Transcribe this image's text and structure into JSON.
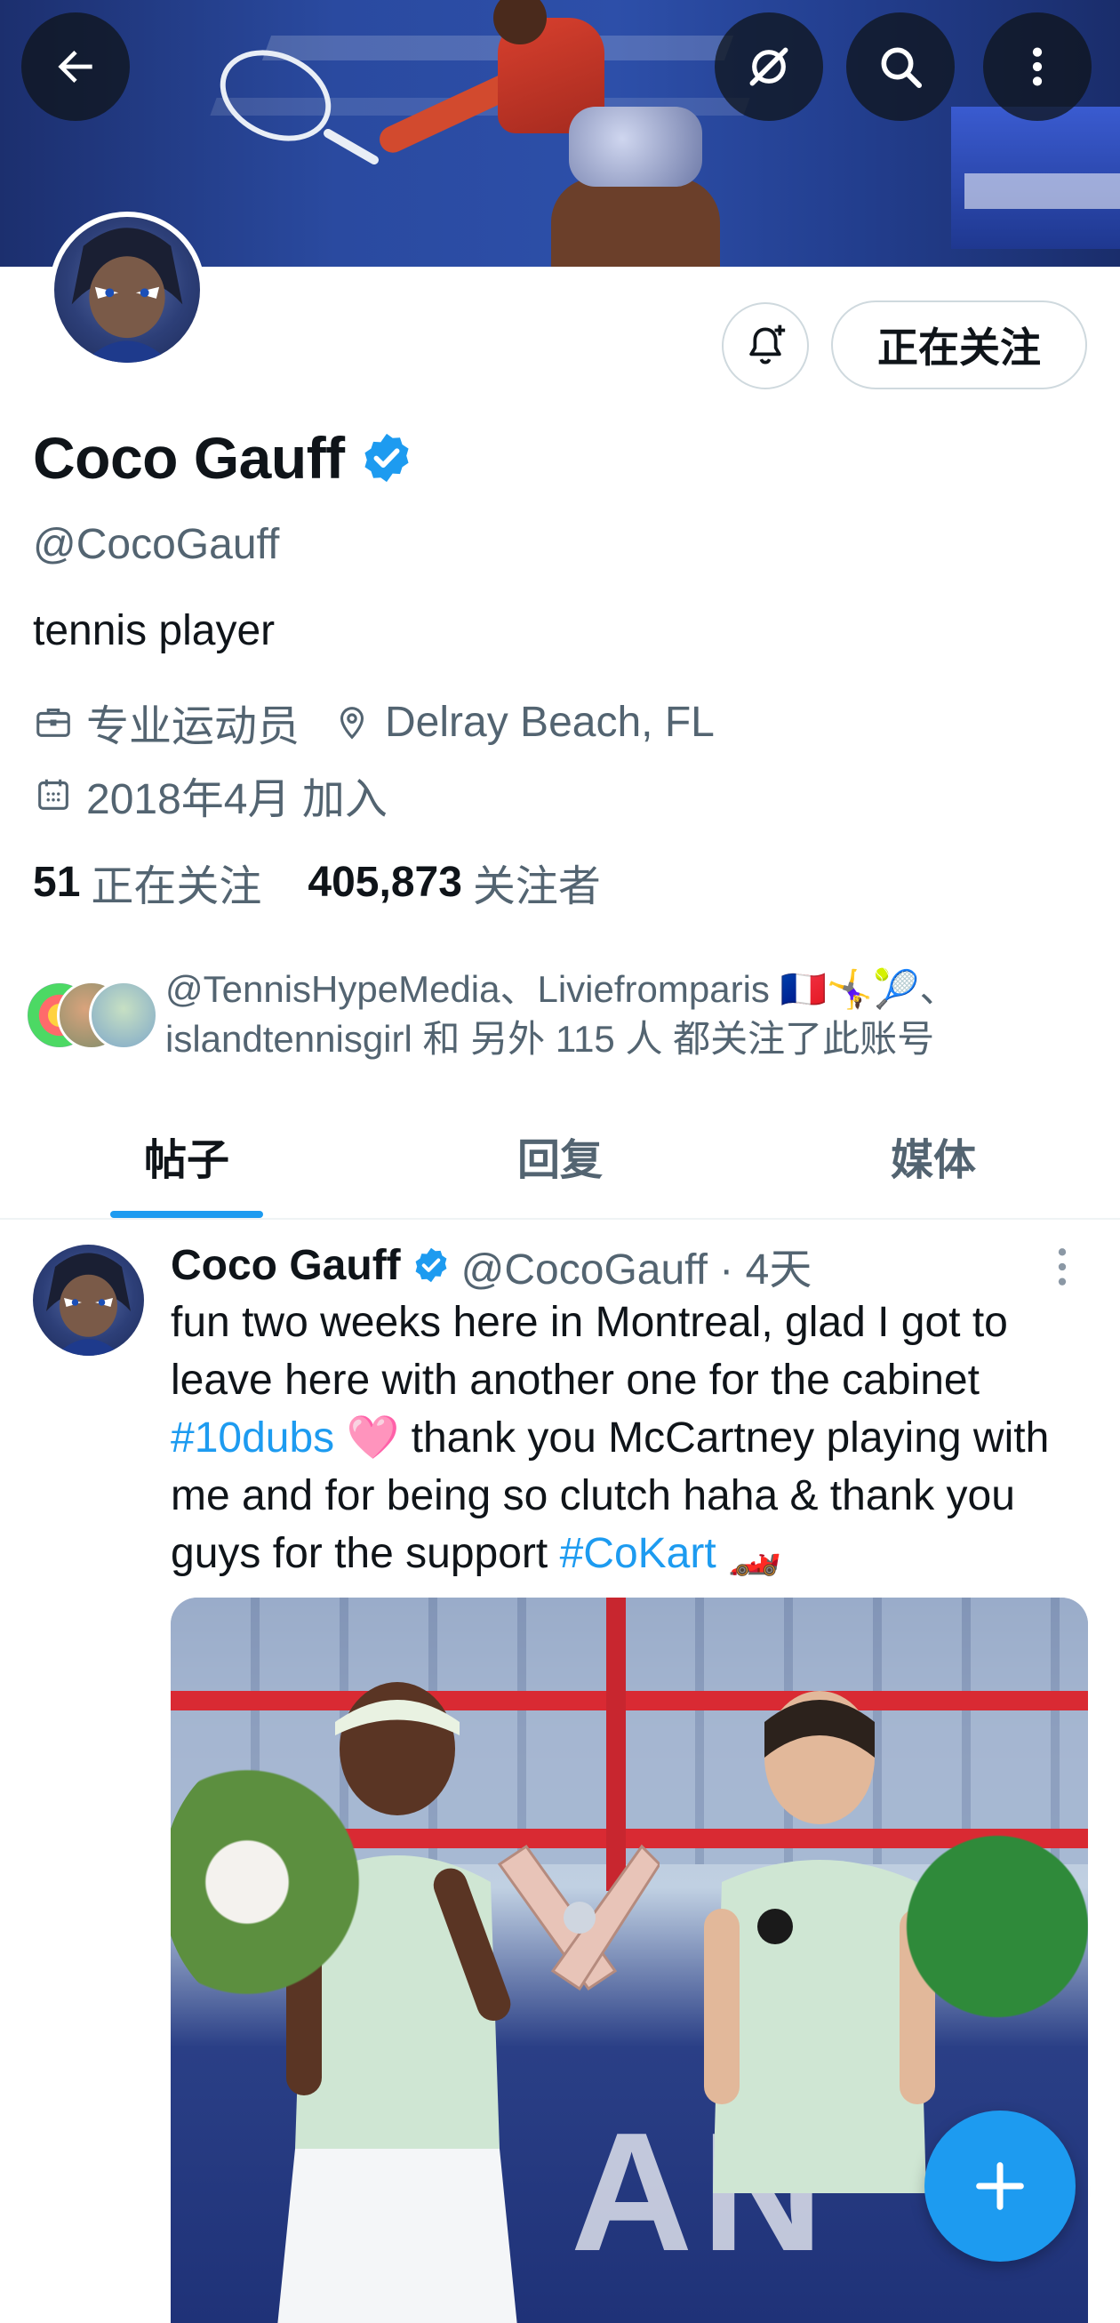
{
  "header": {
    "back_icon": "arrow-left-icon",
    "grok_icon": "grok-icon",
    "search_icon": "search-icon",
    "more_icon": "more-vertical-icon"
  },
  "profile": {
    "name": "Coco Gauff",
    "handle": "@CocoGauff",
    "bio": "tennis player",
    "category": "专业运动员",
    "location": "Delray Beach, FL",
    "joined": "2018年4月 加入",
    "follow_button": "正在关注",
    "following_count": "51",
    "following_label": "正在关注",
    "followers_count": "405,873",
    "followers_label": "关注者",
    "followed_by_line1": "@TennisHypeMedia、Liviefromparis 🇫🇷🤸‍♀️🎾、",
    "followed_by_line2": "islandtennisgirl 和 另外 115 人 都关注了此账号"
  },
  "tabs": [
    {
      "label": "帖子",
      "active": true
    },
    {
      "label": "回复",
      "active": false
    },
    {
      "label": "媒体",
      "active": false
    }
  ],
  "post": {
    "name": "Coco Gauff",
    "handle_time": "@CocoGauff · 4天",
    "text_part1": "fun two weeks here in Montreal, glad I got to leave here with another one for the cabinet ",
    "hashtag1": "#10dubs",
    "text_part2": " 🩷 thank you McCartney playing with me and for being so clutch haha & thank you guys for the support ",
    "hashtag2": "#CoKart",
    "text_part3": " 🏎️",
    "image_banner_text": "AN"
  },
  "colors": {
    "accent": "#1d9bf0",
    "text_primary": "#0f1419",
    "text_secondary": "#536471"
  }
}
